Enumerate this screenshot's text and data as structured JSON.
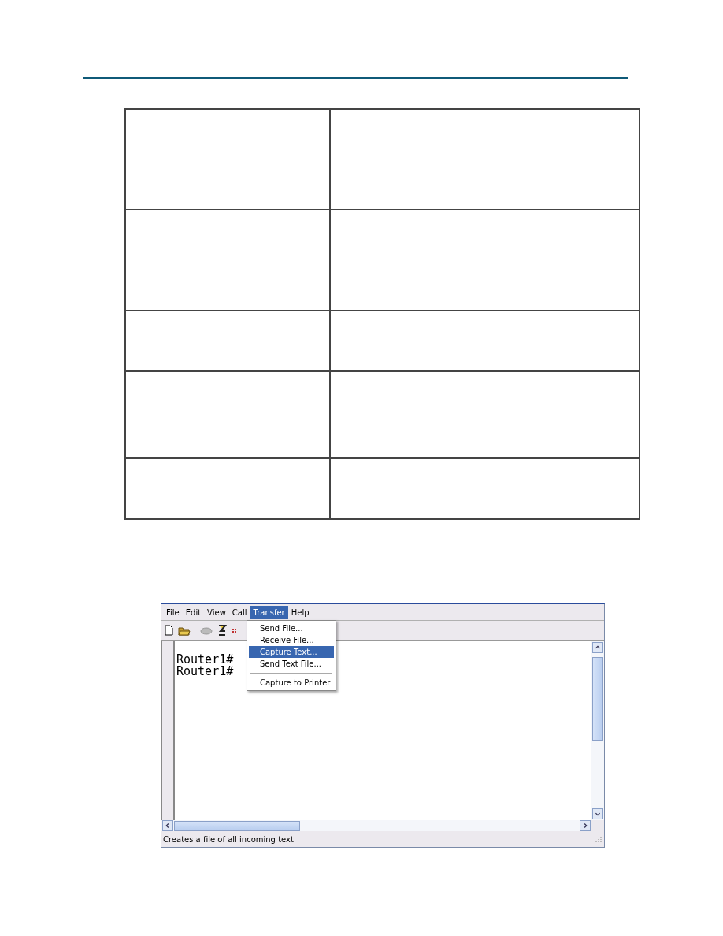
{
  "menu_bar": [
    {
      "label": "File",
      "selected": false
    },
    {
      "label": "Edit",
      "selected": false
    },
    {
      "label": "View",
      "selected": false
    },
    {
      "label": "Call",
      "selected": false
    },
    {
      "label": "Transfer",
      "selected": true
    },
    {
      "label": "Help",
      "selected": false
    }
  ],
  "dropdown": [
    {
      "kind": "item",
      "label": "Send File...",
      "selected": false
    },
    {
      "kind": "item",
      "label": "Receive File...",
      "selected": false
    },
    {
      "kind": "item",
      "label": "Capture Text...",
      "selected": true
    },
    {
      "kind": "item",
      "label": "Send Text File...",
      "selected": false
    },
    {
      "kind": "separator"
    },
    {
      "kind": "item",
      "label": "Capture to Printer",
      "selected": false
    }
  ],
  "terminal": {
    "lines": [
      "Router1#",
      "Router1#"
    ]
  },
  "status_bar": {
    "text": "Creates a file of all incoming text"
  }
}
